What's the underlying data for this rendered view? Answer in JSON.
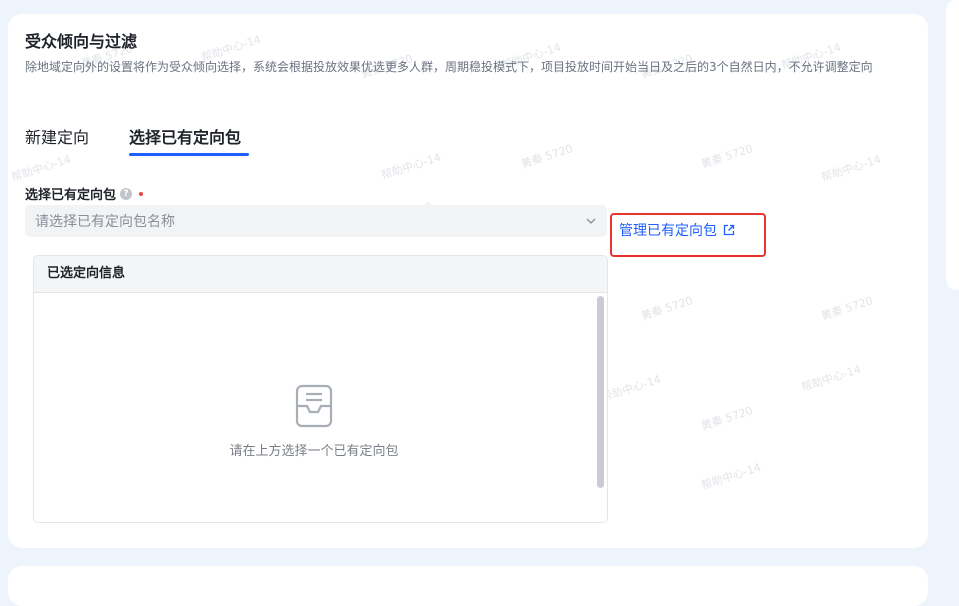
{
  "section": {
    "title": "受众倾向与过滤",
    "description": "除地域定向外的设置将作为受众倾向选择，系统会根据投放效果优选更多人群，周期稳投模式下，项目投放时间开始当日及之后的3个自然日内，不允许调整定向"
  },
  "tabs": [
    {
      "label": "新建定向",
      "active": false
    },
    {
      "label": "选择已有定向包",
      "active": true
    }
  ],
  "field": {
    "label": "选择已有定向包",
    "help_icon": "question-circle-icon",
    "select_placeholder": "请选择已有定向包名称",
    "manage_link": "管理已有定向包"
  },
  "info_panel": {
    "header": "已选定向信息",
    "empty_text": "请在上方选择一个已有定向包"
  },
  "watermarks": [
    "黄秦 5720",
    "帮助中心-14"
  ],
  "colors": {
    "accent": "#1f5fff",
    "highlight_border": "#e8342e",
    "required": "#f04142"
  }
}
